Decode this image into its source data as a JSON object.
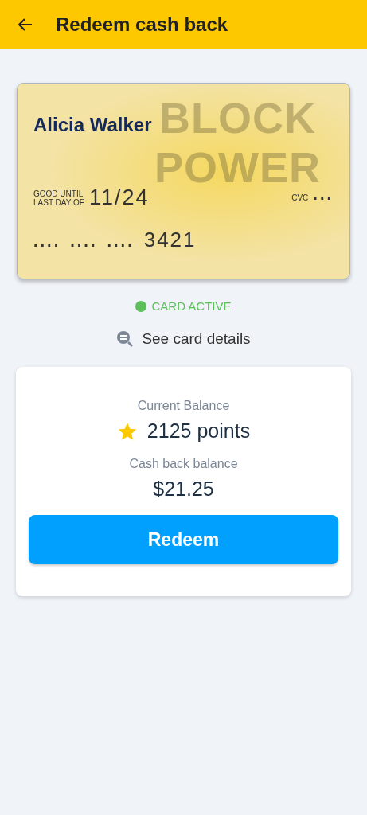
{
  "app_bar": {
    "title": "Redeem cash back"
  },
  "card": {
    "logo_lines": [
      "BLOCK",
      "POWER"
    ],
    "holder": "Alicia Walker",
    "expiry_caption": [
      "GOOD UNTIL",
      "LAST DAY OF"
    ],
    "expiry": "11/24",
    "cvc_label": "CVC",
    "cvc": "...",
    "number_groups": [
      "....",
      "....",
      "....",
      "3421"
    ]
  },
  "card_status": {
    "label": "CARD ACTIVE",
    "active": true,
    "color": "#5cbf5a"
  },
  "details_link": "See card details",
  "balance": {
    "points_label": "Current Balance",
    "points": "2125 points",
    "cash_label": "Cash back balance",
    "cash": "$21.25",
    "button": "Redeem"
  }
}
